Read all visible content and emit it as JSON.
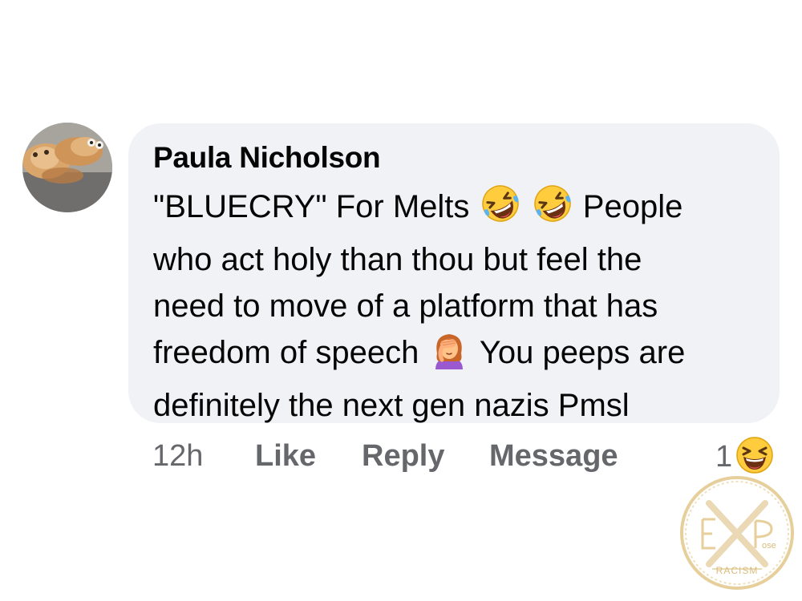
{
  "comment": {
    "author": "Paula Nicholson",
    "lines": [
      {
        "before": "\"BLUECRY\" For Melts",
        "after": "People"
      },
      {
        "text": "who act holy than thou but feel the"
      },
      {
        "text": "need to move of a platform that has"
      },
      {
        "before": "freedom of speech",
        "after": "You peeps are"
      },
      {
        "text": "definitely the next gen nazis Pmsl"
      }
    ]
  },
  "actions": {
    "time": "12h",
    "like": "Like",
    "reply": "Reply",
    "message": "Message"
  },
  "reactions": {
    "count": "1",
    "icon": "laughing-face-icon"
  },
  "watermark": {
    "text": "EXPose RACISM"
  },
  "colors": {
    "bubble": "#f0f2f5",
    "text": "#050505",
    "secondary": "#65676b",
    "emoji_yellow": "#ffcc3d",
    "watermark_gold": "#e6cf9b"
  }
}
